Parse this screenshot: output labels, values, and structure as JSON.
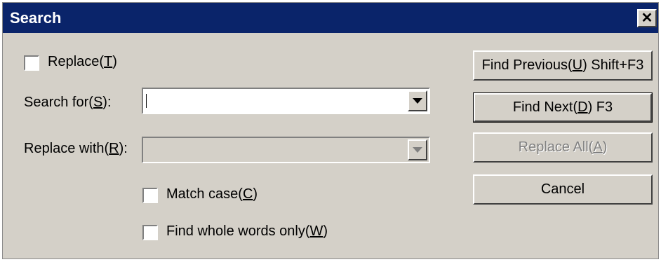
{
  "dialog": {
    "title": "Search",
    "close_glyph": "✕"
  },
  "options": {
    "replace": {
      "text": "Replace(",
      "key": "T",
      "end": ")",
      "checked": false
    },
    "match_case": {
      "text": "Match case(",
      "key": "C",
      "end": ")",
      "checked": false
    },
    "whole_words": {
      "text": "Find whole words only(",
      "key": "W",
      "end": ")",
      "checked": false
    }
  },
  "fields": {
    "search_for": {
      "text": "Search for(",
      "key": "S",
      "end": "):",
      "value": ""
    },
    "replace_with": {
      "text": "Replace with(",
      "key": "R",
      "end": "):",
      "value": "",
      "disabled": true
    }
  },
  "buttons": {
    "find_previous": {
      "text": "Find Previous(",
      "key": "U",
      "end": ") Shift+F3"
    },
    "find_next": {
      "text": "Find Next(",
      "key": "D",
      "end": ") F3"
    },
    "replace_all": {
      "text": "Replace All(",
      "key": "A",
      "end": ")",
      "disabled": true
    },
    "cancel": {
      "text": "Cancel"
    }
  },
  "colors": {
    "titlebar": "#0a246a",
    "face": "#d4d0c8"
  }
}
